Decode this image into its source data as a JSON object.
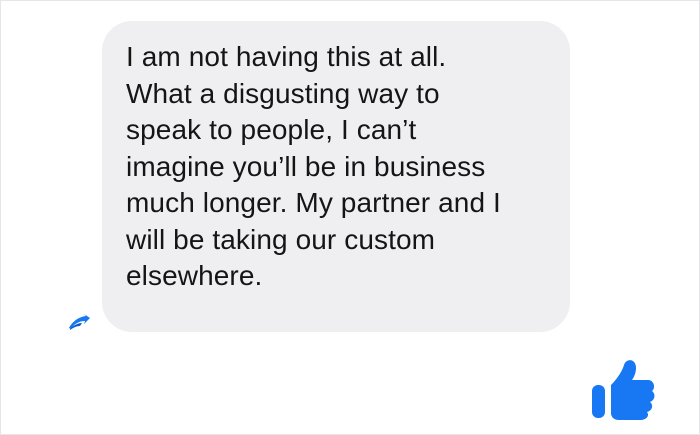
{
  "conversation": {
    "message": {
      "text": "I am not having this at all.\nWhat a disgusting way to\nspeak to people, I can’t\nimagine you’ll be in business\nmuch longer. My partner and I\nwill be taking our custom\nelsewhere."
    },
    "icons": {
      "reply": "reply-icon",
      "like": "thumbs-up-icon"
    },
    "colors": {
      "bubble_background": "#efeff1",
      "text": "#151515",
      "accent": "#1877f2",
      "background": "#ffffff"
    }
  }
}
